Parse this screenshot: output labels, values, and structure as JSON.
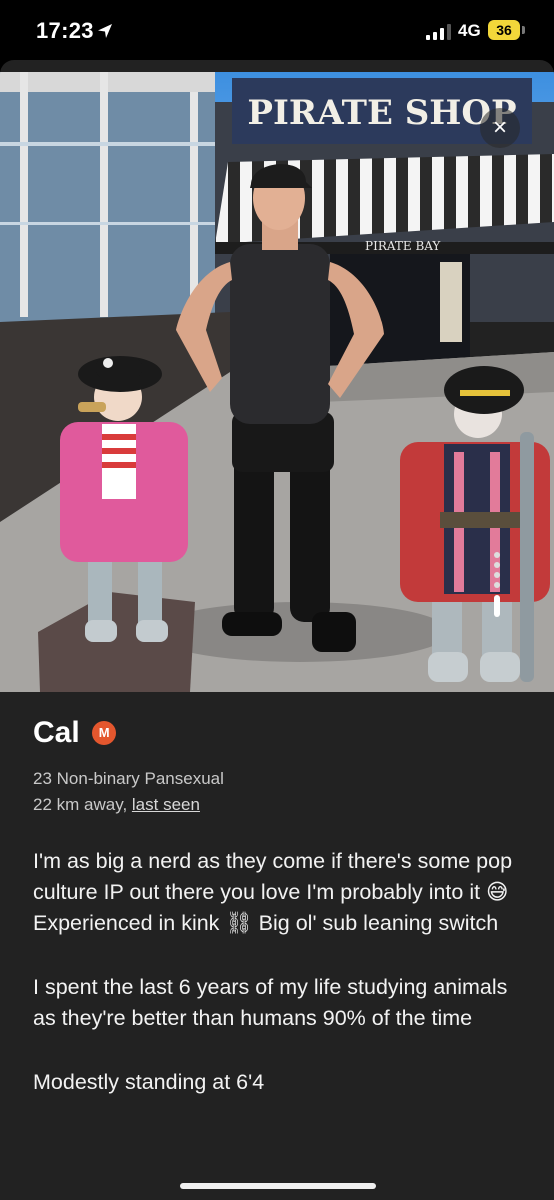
{
  "status_bar": {
    "time": "17:23",
    "network": "4G",
    "battery": "36"
  },
  "photo": {
    "sign_text": "PIRATE SHOP",
    "awning_text": "PIRATE BAY",
    "close_label": "×"
  },
  "profile": {
    "name": "Cal",
    "badge": "M",
    "details_line1": "23 Non-binary Pansexual",
    "distance": "22 km away,",
    "last_seen": "last seen",
    "bio": [
      "I'm as big a nerd as they come if there's some pop culture IP out there you love I'm probably into it 😅 Experienced in kink ⛓ Big ol' sub leaning switch",
      "I spent the last 6 years of my life studying animals as they're better than humans 90% of the time",
      "Modestly standing at 6'4"
    ]
  },
  "colors": {
    "sheet_bg": "#222222",
    "badge": "#e4572e",
    "battery": "#f2d73a"
  }
}
